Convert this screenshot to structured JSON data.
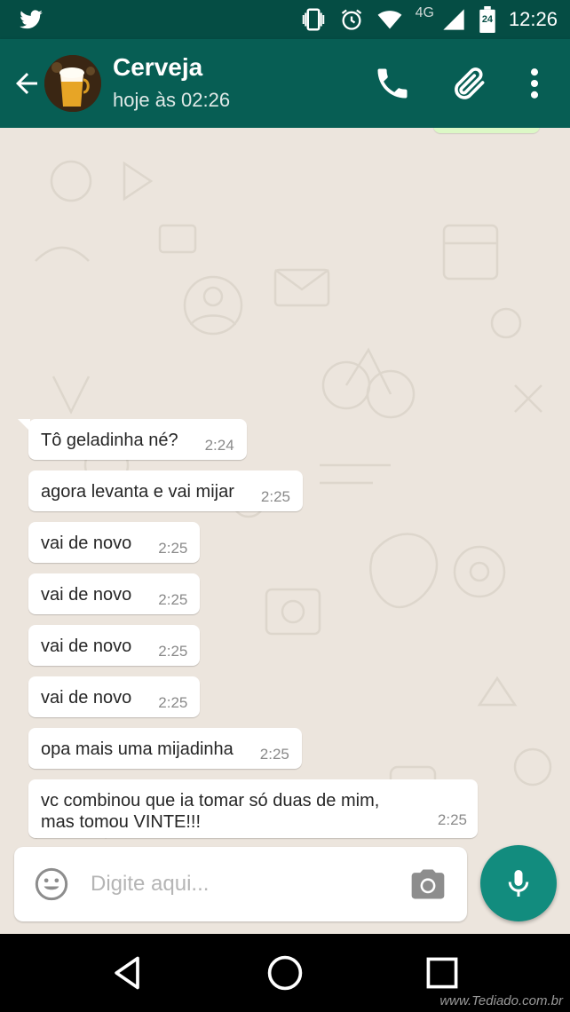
{
  "status_bar": {
    "time": "12:26",
    "network": "4G",
    "battery_level": "24",
    "icons": [
      "twitter-icon",
      "vibrate-icon",
      "alarm-icon",
      "wifi-icon",
      "signal-icon",
      "battery-icon"
    ]
  },
  "chat_header": {
    "contact_name": "Cerveja",
    "last_seen": "hoje às 02:26",
    "icons": [
      "back-arrow-icon",
      "phone-icon",
      "paperclip-icon",
      "more-vert-icon"
    ]
  },
  "messages": [
    {
      "text": "Tô geladinha né?",
      "time": "2:24"
    },
    {
      "text": "agora levanta e vai mijar",
      "time": "2:25"
    },
    {
      "text": "vai de novo",
      "time": "2:25"
    },
    {
      "text": "vai de novo",
      "time": "2:25"
    },
    {
      "text": "vai de novo",
      "time": "2:25"
    },
    {
      "text": "vai de novo",
      "time": "2:25"
    },
    {
      "text": "opa mais uma mijadinha",
      "time": "2:25"
    },
    {
      "text": "vc combinou que ia tomar só duas de mim, mas tomou VINTE!!!",
      "time": "2:25"
    }
  ],
  "composer": {
    "placeholder": "Digite aqui...",
    "icons": [
      "emoji-icon",
      "camera-icon",
      "mic-icon"
    ]
  },
  "nav_bar": {
    "icons": [
      "nav-back-icon",
      "nav-home-icon",
      "nav-recents-icon"
    ]
  },
  "watermark": "www.Tediado.com.br",
  "colors": {
    "status_bar": "#054d44",
    "app_bar": "#075e54",
    "mic_button": "#128c7e",
    "chat_background": "#ece5dd",
    "bubble": "#ffffff"
  }
}
